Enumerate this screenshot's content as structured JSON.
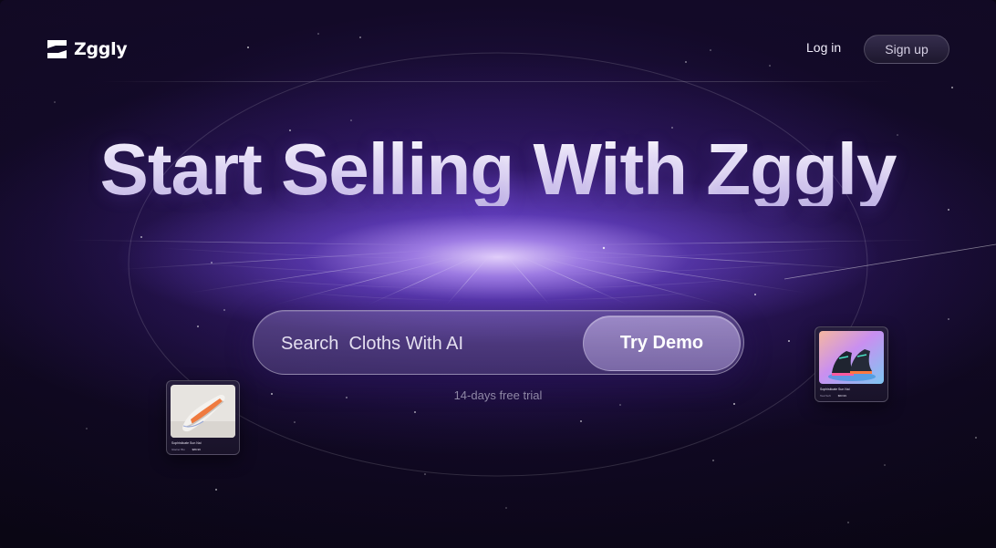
{
  "app": {
    "brand_name": "Zggly"
  },
  "nav": {
    "login_label": "Log in",
    "signup_label": "Sign up"
  },
  "hero": {
    "title": "Start Selling With Zggly"
  },
  "search": {
    "placeholder": "Search  Cloths With AI",
    "button_label": "Try Demo",
    "trial_note": "14-days free trial"
  },
  "products": [
    {
      "image": "white-orange-sneaker-image",
      "title": "Sophisticate Sun Nai",
      "meta": "Glacier Blu",
      "price": "$89.99"
    },
    {
      "image": "neon-black-sneakers-image",
      "title": "Sophisticate Sun Nai",
      "meta": "Teal Soft",
      "price": "$63.99"
    }
  ],
  "colors": {
    "background": "#0b0716",
    "glow": "#b896ff",
    "accent": "#8e7cba",
    "muted_text": "#8f88a6"
  }
}
